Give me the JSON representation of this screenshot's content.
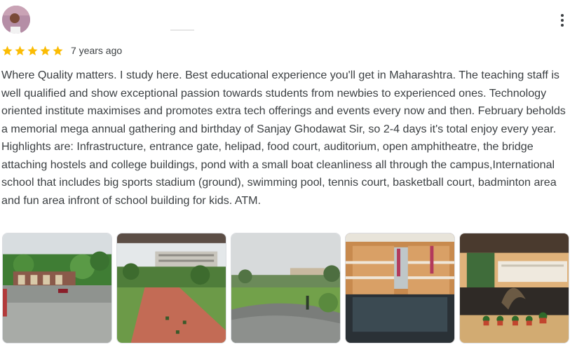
{
  "review": {
    "avatar": "user-avatar",
    "more_icon": "more-vert-icon",
    "rating": 5,
    "rating_max": 5,
    "star_color": "#fbbc04",
    "timestamp": "7 years ago",
    "text": "Where Quality matters. I study here. Best educational experience you'll get in Maharashtra. The teaching staff is well qualified and show exceptional passion towards students from newbies to experienced ones. Technology oriented institute maximises and promotes extra tech offerings and events every now and then. February beholds a memorial mega annual gathering and birthday of Sanjay Ghodawat Sir, so 2-4 days it's total enjoy every year. Highlights are: Infrastructure, entrance gate, helipad, food court, auditorium, open amphitheatre, the bridge attaching hostels and college buildings, pond with a small boat cleanliness all through the campus,International school that includes big sports stadium (ground), swimming pool, tennis court, basketball court, badminton area and fun area infront of school building for kids. ATM.",
    "photos_count": 5
  }
}
